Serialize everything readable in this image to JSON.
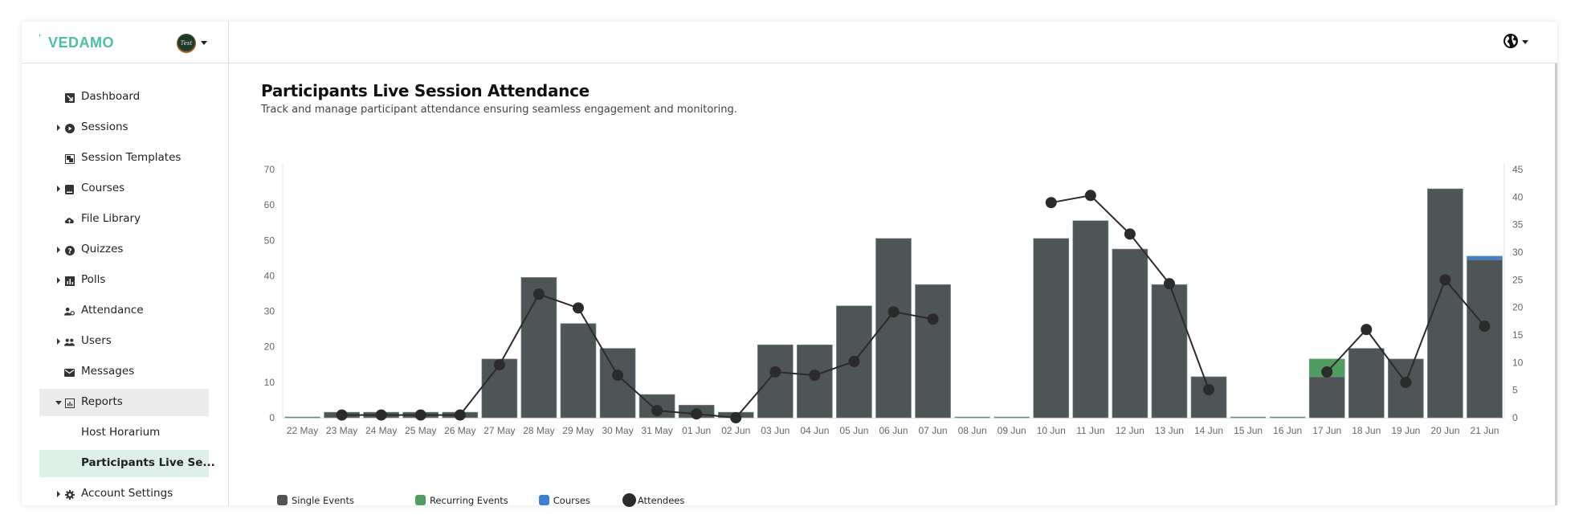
{
  "app": {
    "logo_text": "VEDAMO",
    "avatar_text": "Test"
  },
  "sidebar": {
    "items": [
      {
        "label": "Dashboard",
        "icon": "dashboard-icon",
        "expandable": false,
        "state": ""
      },
      {
        "label": "Sessions",
        "icon": "play-circle-icon",
        "expandable": true,
        "state": ""
      },
      {
        "label": "Session Templates",
        "icon": "template-icon",
        "expandable": false,
        "state": ""
      },
      {
        "label": "Courses",
        "icon": "book-icon",
        "expandable": true,
        "state": ""
      },
      {
        "label": "File Library",
        "icon": "cloud-upload-icon",
        "expandable": false,
        "state": ""
      },
      {
        "label": "Quizzes",
        "icon": "question-circle-icon",
        "expandable": true,
        "state": ""
      },
      {
        "label": "Polls",
        "icon": "bar-chart-icon",
        "expandable": true,
        "state": ""
      },
      {
        "label": "Attendance",
        "icon": "user-check-icon",
        "expandable": false,
        "state": ""
      },
      {
        "label": "Users",
        "icon": "users-icon",
        "expandable": true,
        "state": ""
      },
      {
        "label": "Messages",
        "icon": "envelope-icon",
        "expandable": false,
        "state": ""
      },
      {
        "label": "Reports",
        "icon": "report-icon",
        "expandable": true,
        "state": "expanded"
      },
      {
        "label": "Host Horarium",
        "icon": "",
        "expandable": false,
        "state": "sub"
      },
      {
        "label": "Participants Live Se...",
        "icon": "",
        "expandable": false,
        "state": "selected"
      },
      {
        "label": "Account Settings",
        "icon": "gear-icon",
        "expandable": true,
        "state": ""
      }
    ]
  },
  "topbar": {
    "language_icon": "globe-icon"
  },
  "page": {
    "title": "Participants Live Session Attendance",
    "subtitle": "Track and manage participant attendance ensuring seamless engagement and monitoring."
  },
  "colors": {
    "single": "#4f5457",
    "recurring": "#4f9e5f",
    "courses": "#3a7fd5",
    "attendees": "#2b2b2b",
    "zero": "#5f8b83",
    "brand": "#4cbea4"
  },
  "chart_data": {
    "type": "bar",
    "stacked": true,
    "title": "",
    "categories": [
      "22 May",
      "23 May",
      "24 May",
      "25 May",
      "26 May",
      "27 May",
      "28 May",
      "29 May",
      "30 May",
      "31 May",
      "01 Jun",
      "02 Jun",
      "03 Jun",
      "04 Jun",
      "05 Jun",
      "06 Jun",
      "07 Jun",
      "08 Jun",
      "09 Jun",
      "10 Jun",
      "11 Jun",
      "12 Jun",
      "13 Jun",
      "14 Jun",
      "15 Jun",
      "16 Jun",
      "17 Jun",
      "18 Jun",
      "19 Jun",
      "20 Jun",
      "21 Jun"
    ],
    "series": [
      {
        "name": "Single Events",
        "axis": "left",
        "kind": "bar",
        "values": [
          0,
          1,
          1,
          1,
          1,
          16,
          39,
          26,
          19,
          6,
          3,
          1,
          20,
          20,
          31,
          50,
          37,
          0,
          0,
          50,
          55,
          47,
          37,
          11,
          0,
          0,
          11,
          19,
          16,
          64,
          44
        ]
      },
      {
        "name": "Recurring Events",
        "axis": "left",
        "kind": "bar",
        "values": [
          0,
          0,
          0,
          0,
          0,
          0,
          0,
          0,
          0,
          0,
          0,
          0,
          0,
          0,
          0,
          0,
          0,
          0,
          0,
          0,
          0,
          0,
          0,
          0,
          0,
          0,
          5,
          0,
          0,
          0,
          0
        ]
      },
      {
        "name": "Courses",
        "axis": "left",
        "kind": "bar",
        "values": [
          0,
          0,
          0,
          0,
          0,
          0,
          0,
          0,
          0,
          0,
          0,
          0,
          0,
          0,
          0,
          0,
          0,
          0,
          0,
          0,
          0,
          0,
          0,
          0,
          0,
          0,
          0,
          0,
          0,
          0,
          1
        ]
      },
      {
        "name": "Attendees",
        "axis": "right",
        "kind": "line",
        "values": [
          null,
          0.5,
          0.5,
          0.5,
          0.5,
          9.6,
          22.4,
          19.9,
          7.7,
          1.3,
          0.7,
          0,
          8.3,
          7.7,
          10.2,
          19.2,
          17.9,
          null,
          null,
          39,
          40.3,
          33.3,
          24.3,
          5.1,
          null,
          null,
          8.3,
          16,
          6.4,
          25,
          16.6
        ]
      }
    ],
    "left_axis": {
      "ylim": [
        0,
        70
      ],
      "ticks": [
        0,
        10,
        20,
        30,
        40,
        50,
        60,
        70
      ]
    },
    "right_axis": {
      "ylim": [
        0,
        45
      ],
      "ticks": [
        0,
        5,
        10,
        15,
        20,
        25,
        30,
        35,
        40,
        45
      ]
    },
    "legend": [
      "Single Events",
      "Recurring Events",
      "Courses",
      "Attendees"
    ],
    "legend_position": "bottom-left",
    "grid": false,
    "xlabel": "",
    "ylabel": ""
  }
}
